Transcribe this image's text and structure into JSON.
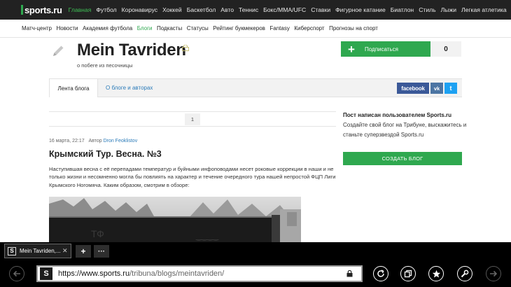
{
  "site": {
    "logo": "sports.ru",
    "nav": [
      "Главная",
      "Футбол",
      "Коронавирус",
      "Хоккей",
      "Баскетбол",
      "Авто",
      "Теннис",
      "Бокс/ММА/UFC",
      "Ставки",
      "Фигурное катание",
      "Биатлон",
      "Стиль",
      "Лыжи",
      "Легкая атлетика"
    ],
    "subnav": [
      "Матч-центр",
      "Новости",
      "Академия футбола",
      "Блоги",
      "Подкасты",
      "Статусы",
      "Рейтинг букмекеров",
      "Fantasy",
      "Киберспорт",
      "Прогнозы на спорт"
    ]
  },
  "blog": {
    "title": "Mein Tavriden",
    "subtitle": "о побеге из песочницы",
    "subscribe_label": "Подписаться",
    "subscribers": "0",
    "tabs": [
      "Лента блога",
      "О блоге и авторах"
    ],
    "share": {
      "facebook": "facebook",
      "vk": "vk",
      "twitter": "t"
    }
  },
  "pagination": {
    "current": "1"
  },
  "post": {
    "date": "16 марта, 22:17",
    "author_label": "Автор",
    "author": "Dron Feoklistov",
    "title": "Крымский Тур. Весна. №3",
    "body": "Наступившая весна с её перепадами температур и буйными инфоповодами несет роковые коррекции в наши и не только жизни и несомненно могла бы повлиять на характер и течение очередного тура нашей непростой ФЦП Лиги Крымского Ногомяча. Каким образом, смотрим в обзоре:"
  },
  "sidebar": {
    "title": "Пост написан пользователем Sports.ru",
    "text": "Создайте свой блог на Трибуне, выскажитесь и станьте суперзвездой Sports.ru",
    "button": "СОЗДАТЬ БЛОГ"
  },
  "browser": {
    "tab_title": "Mein Tavriden,...",
    "tab_close": "✕",
    "new_tab": "+",
    "more": "···",
    "url_main": "https://www.sports.ru",
    "url_rest": "/tribuna/blogs/meintavriden/",
    "site_icon_letter": "S",
    "favicon_letter": "S"
  },
  "colors": {
    "brand_green": "#2fa84f",
    "link_blue": "#2b7bb9",
    "topbar": "#222222"
  }
}
